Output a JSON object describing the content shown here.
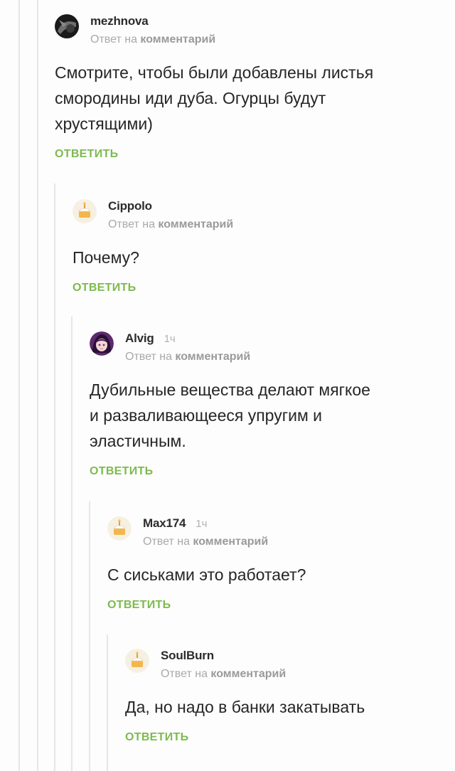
{
  "comments": [
    {
      "author": "mezhnova",
      "time": "",
      "reply_prefix": "Ответ на",
      "reply_target": "комментарий",
      "text_lines": [
        "Смотрите, чтобы были добавлены листья",
        "смородины иди дуба. Огурцы будут",
        "хрустящими)"
      ],
      "reply_label": "ОТВЕТИТЬ"
    },
    {
      "author": "Cippolo",
      "time": "",
      "reply_prefix": "Ответ на",
      "reply_target": "комментарий",
      "text_lines": [
        "Почему?"
      ],
      "reply_label": "ОТВЕТИТЬ"
    },
    {
      "author": "Alvig",
      "time": "1ч",
      "reply_prefix": "Ответ на",
      "reply_target": "комментарий",
      "text_lines": [
        "Дубильные вещества делают мягкое",
        "и разваливающееся упругим и",
        "эластичным."
      ],
      "reply_label": "ОТВЕТИТЬ"
    },
    {
      "author": "Max174",
      "time": "1ч",
      "reply_prefix": "Ответ на",
      "reply_target": "комментарий",
      "text_lines": [
        "С сиськами это работает?"
      ],
      "reply_label": "ОТВЕТИТЬ"
    },
    {
      "author": "SoulBurn",
      "time": "",
      "reply_prefix": "Ответ на",
      "reply_target": "комментарий",
      "text_lines": [
        "Да, но надо в банки закатывать"
      ],
      "reply_label": "ОТВЕТИТЬ"
    }
  ],
  "colors": {
    "reply_button": "#7dba4f",
    "thread_line": "#e6e6e6",
    "muted_text": "#a9a9a9"
  },
  "icons": {
    "mezhnova": "dark-photo-avatar-icon",
    "Cippolo": "default-cake-avatar-icon",
    "Alvig": "anime-girl-avatar-icon",
    "Max174": "default-cake-avatar-icon",
    "SoulBurn": "default-cake-avatar-icon"
  }
}
